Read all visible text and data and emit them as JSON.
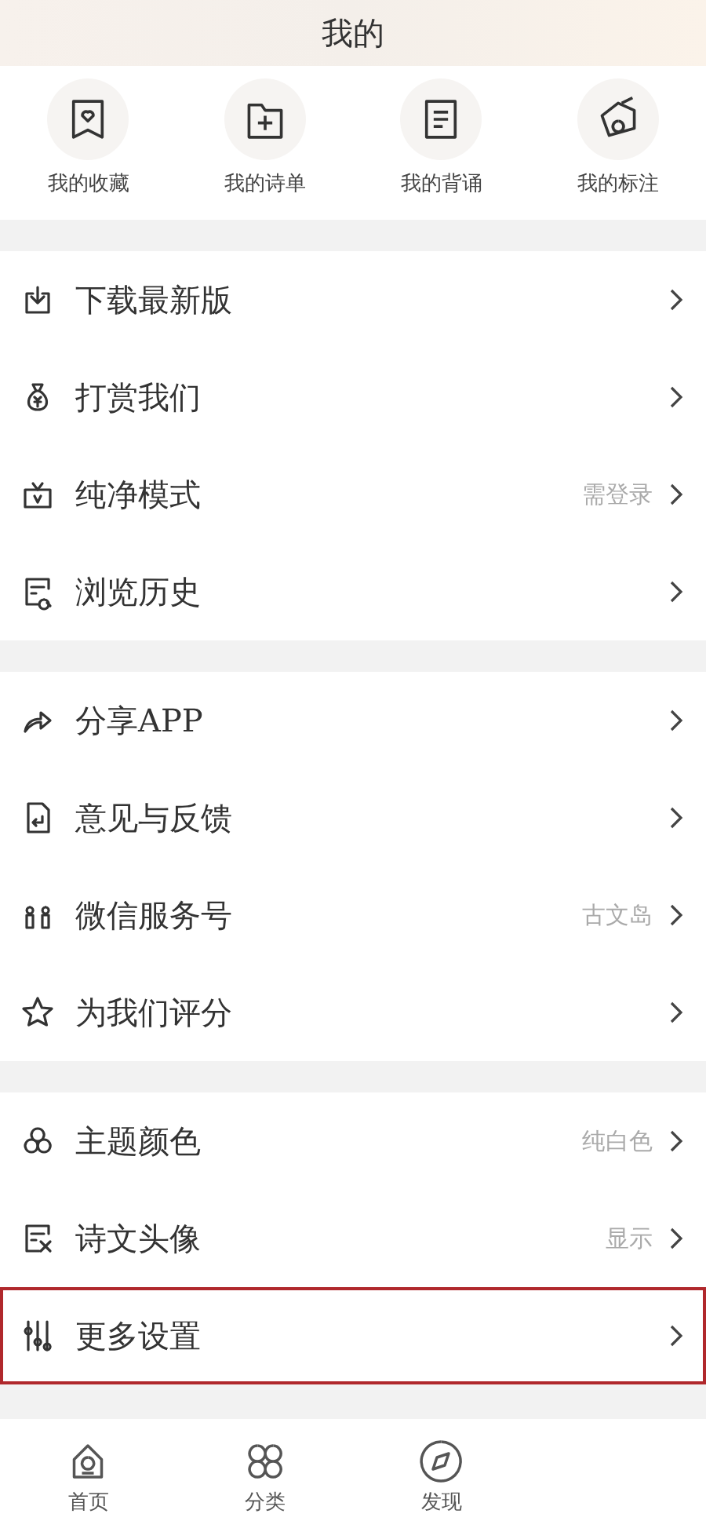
{
  "header": {
    "title": "我的"
  },
  "shortcuts": [
    {
      "label": "我的收藏"
    },
    {
      "label": "我的诗单"
    },
    {
      "label": "我的背诵"
    },
    {
      "label": "我的标注"
    }
  ],
  "sections": [
    {
      "items": [
        {
          "label": "下载最新版",
          "highlighted": false
        },
        {
          "label": "打赏我们",
          "highlighted": false
        },
        {
          "label": "纯净模式",
          "value": "需登录",
          "highlighted": false
        },
        {
          "label": "浏览历史",
          "highlighted": false
        }
      ]
    },
    {
      "items": [
        {
          "label": "分享APP",
          "highlighted": false
        },
        {
          "label": "意见与反馈",
          "highlighted": false
        },
        {
          "label": "微信服务号",
          "value": "古文岛",
          "highlighted": false
        },
        {
          "label": "为我们评分",
          "highlighted": false
        }
      ]
    },
    {
      "items": [
        {
          "label": "主题颜色",
          "value": "纯白色",
          "highlighted": false
        },
        {
          "label": "诗文头像",
          "value": "显示",
          "highlighted": false
        },
        {
          "label": "更多设置",
          "highlighted": true
        }
      ]
    }
  ],
  "tab_bar": [
    {
      "label": "首页",
      "selected": false
    },
    {
      "label": "分类",
      "selected": false
    },
    {
      "label": "发现",
      "selected": false
    }
  ]
}
